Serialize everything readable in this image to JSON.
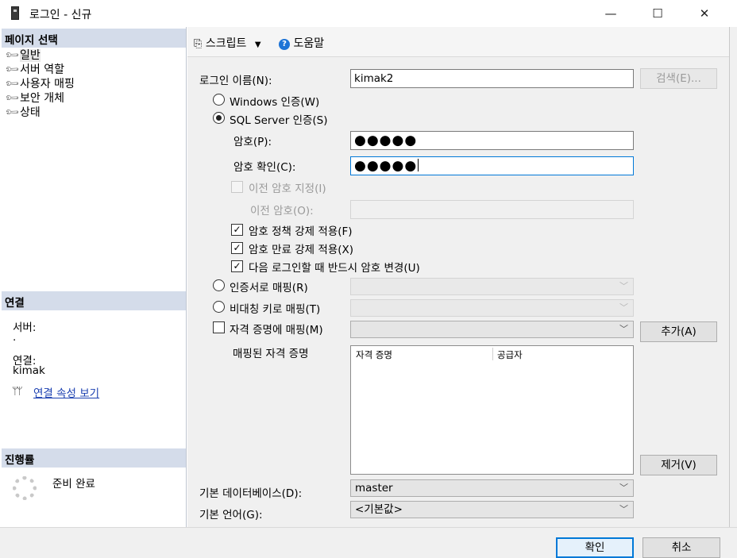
{
  "window": {
    "title": "로그인 - 신규",
    "minimize": "—",
    "maximize": "☐",
    "close": "✕"
  },
  "left": {
    "page_select_header": "페이지 선택",
    "nav": [
      "일반",
      "서버 역할",
      "사용자 매핑",
      "보안 개체",
      "상태"
    ],
    "connection_header": "연결",
    "server_label": "서버:",
    "server_value": ".",
    "connection_label": "연결:",
    "connection_value": "kimak",
    "view_props_link": "연결 속성 보기",
    "progress_header": "진행률",
    "progress_status": "준비 완료"
  },
  "toolbar": {
    "script": "스크립트",
    "help": "도움말"
  },
  "form": {
    "login_name_label": "로그인 이름(N):",
    "login_name_value": "kimak2",
    "search_button": "검색(E)...",
    "windows_auth": "Windows 인증(W)",
    "sql_auth": "SQL Server 인증(S)",
    "password_label": "암호(P):",
    "password_value": "●●●●●",
    "confirm_label": "암호 확인(C):",
    "confirm_value": "●●●●●",
    "specify_old": "이전 암호 지정(I)",
    "old_password_label": "이전 암호(O):",
    "enforce_policy": "암호 정책 강제 적용(F)",
    "enforce_expiration": "암호 만료 강제 적용(X)",
    "must_change": "다음 로그인할 때 반드시 암호 변경(U)",
    "cert_map": "인증서로 매핑(R)",
    "asym_key_map": "비대칭 키로 매핑(T)",
    "credential_map": "자격 증명에 매핑(M)",
    "add_button": "추가(A)",
    "mapped_credentials_label": "매핑된 자격 증명",
    "col_credential": "자격 증명",
    "col_provider": "공급자",
    "remove_button": "제거(V)",
    "default_db_label": "기본 데이터베이스(D):",
    "default_db_value": "master",
    "default_lang_label": "기본 언어(G):",
    "default_lang_value": "<기본값>"
  },
  "footer": {
    "ok": "확인",
    "cancel": "취소"
  },
  "colors": {
    "header_bg": "#d4dcea",
    "accent": "#0078d7",
    "link": "#1a3fb0"
  },
  "icons": [
    "app-icon",
    "wrench-icon",
    "script-icon",
    "help-icon",
    "connection-props-icon",
    "spinner-icon",
    "chevron-down-icon",
    "check-icon"
  ]
}
